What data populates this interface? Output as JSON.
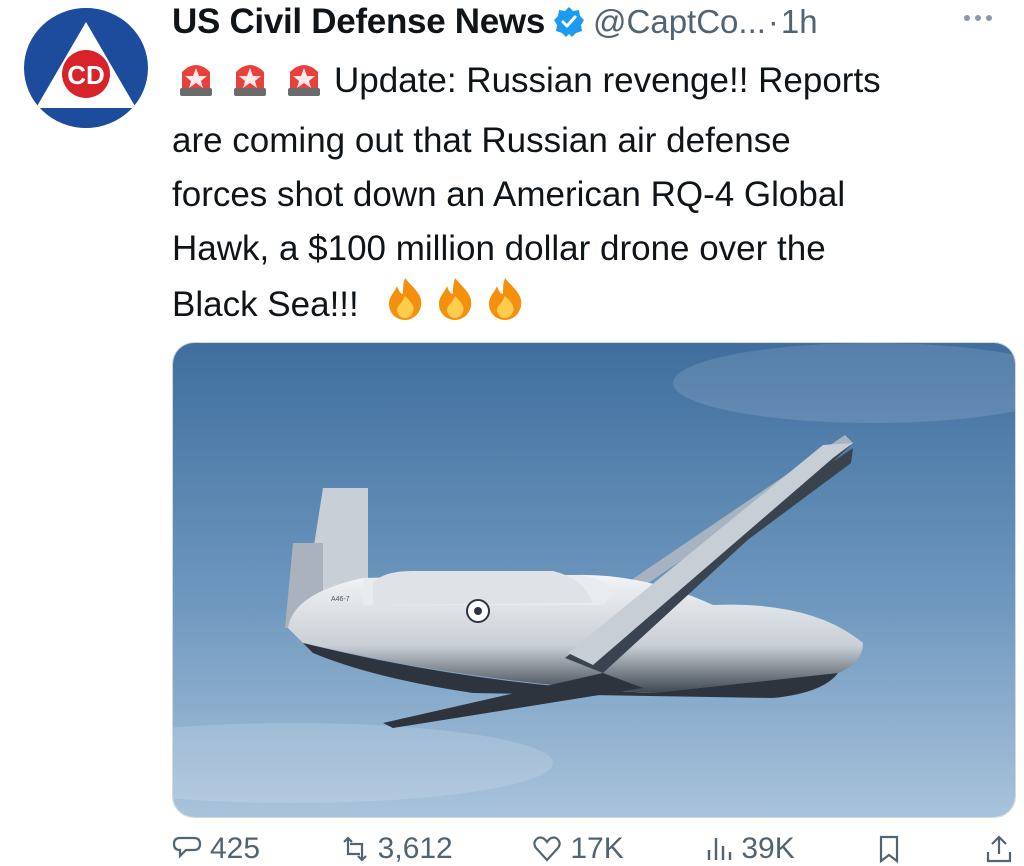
{
  "tweet": {
    "author": {
      "display_name": "US Civil Defense News",
      "handle": "@CaptCo...",
      "separator": "·",
      "time": "1h",
      "avatar_text": "CD",
      "verified": true
    },
    "text": {
      "line1": "Update: Russian revenge!! Reports",
      "line2": "are coming out that Russian air defense",
      "line3": "forces shot down an American  RQ-4 Global",
      "line4": "Hawk, a $100 million dollar drone over the",
      "line5": "Black Sea!!!"
    },
    "leading_emoji": [
      "siren-emoji",
      "siren-emoji",
      "siren-emoji"
    ],
    "trailing_emoji": [
      "fire-emoji",
      "fire-emoji",
      "fire-emoji"
    ],
    "media": {
      "description_icon": "drone-photo",
      "tail_marking": "A46-7"
    },
    "actions": {
      "reply_count": "425",
      "retweet_count": "3,612",
      "like_count": "17K",
      "views_count": "39K"
    }
  },
  "colors": {
    "brand_blue": "#1d4c9c",
    "triangle_white": "#ffffff",
    "cd_red": "#d8232a",
    "verified_blue": "#1d9bf0",
    "secondary_text": "#536471"
  }
}
